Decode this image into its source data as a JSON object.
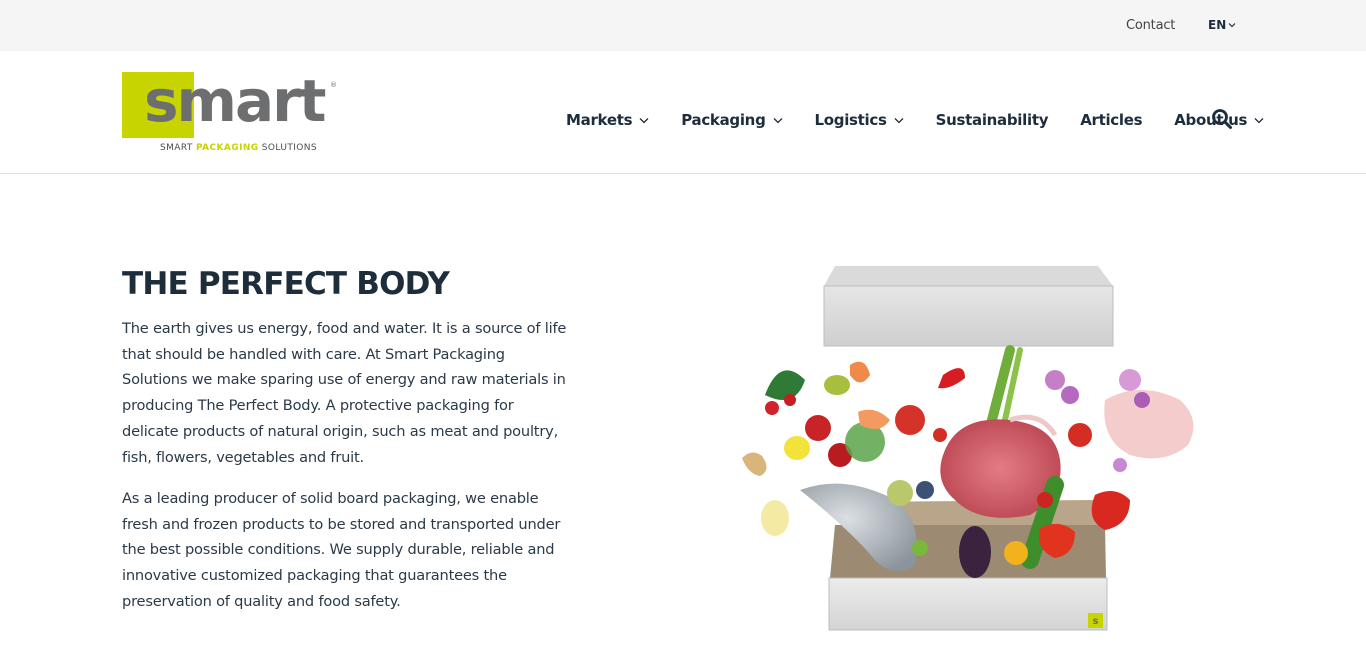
{
  "topbar": {
    "contact_label": "Contact",
    "language": "EN"
  },
  "logo": {
    "word": "smart",
    "reg_mark": "®",
    "tagline_pre": "SMART ",
    "tagline_highlight": "PACKAGING",
    "tagline_post": " SOLUTIONS"
  },
  "nav": {
    "items": [
      {
        "label": "Markets",
        "has_dropdown": true
      },
      {
        "label": "Packaging",
        "has_dropdown": true
      },
      {
        "label": "Logistics",
        "has_dropdown": true
      },
      {
        "label": "Sustainability",
        "has_dropdown": false
      },
      {
        "label": "Articles",
        "has_dropdown": false
      },
      {
        "label": "About us",
        "has_dropdown": true
      }
    ],
    "search_icon": "search-icon"
  },
  "hero": {
    "title": "THE PERFECT BODY",
    "paragraph_1": "The earth gives us energy, food and water. It is a source of life that should be handled with care. At Smart Packaging Solutions we make sparing use of energy and raw materials in producing The Perfect Body. A protective packaging for delicate products of natural origin, such as meat and poultry, fish, flowers, vegetables and fruit.",
    "paragraph_2": "As a leading producer of solid board packaging, we enable fresh and frozen products to be stored and transported under the best possible conditions. We supply durable, reliable and innovative customized packaging that guarantees the preservation of quality and food safety."
  },
  "colors": {
    "brand_green": "#c8d400",
    "brand_gray": "#6d6e70",
    "text_dark": "#1e2d3b",
    "topbar_bg": "#f5f5f5"
  }
}
